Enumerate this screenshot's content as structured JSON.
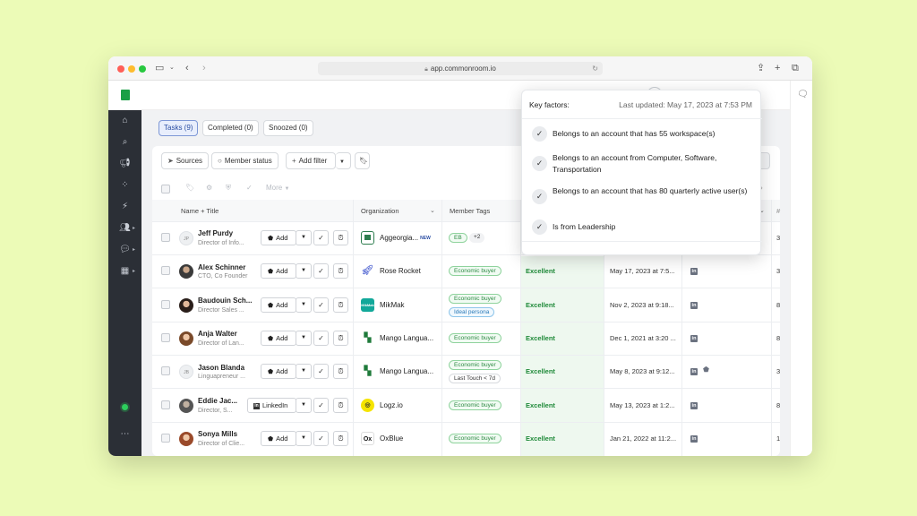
{
  "browser": {
    "url": "app.commonroom.io"
  },
  "tabs": [
    {
      "label": "Tasks (9)",
      "active": true
    },
    {
      "label": "Completed (0)",
      "active": false
    },
    {
      "label": "Snoozed (0)",
      "active": false
    }
  ],
  "filters": {
    "sources": "Sources",
    "member_status": "Member status",
    "add_filter": "Add filter"
  },
  "toolbar": {
    "more": "More"
  },
  "columns": {
    "name_title": "Name + Title",
    "organization": "Organization",
    "member_tags": "Member Tags"
  },
  "rows": [
    {
      "avatar": "JP",
      "name": "Jeff Purdy",
      "title": "Director of Info...",
      "action": "Add",
      "org": "Aggeorgia...",
      "org_new": "NEW",
      "tags": [
        "EB",
        "+2"
      ],
      "score": "",
      "date": ""
    },
    {
      "avatar": "",
      "name": "Alex Schinner",
      "title": "CTO, Co Founder",
      "action": "Add",
      "org": "Rose Rocket",
      "tags": [
        "Economic buyer"
      ],
      "score": "Excellent",
      "date": "May 17, 2023 at 7:5..."
    },
    {
      "avatar": "",
      "name": "Baudouin Sch...",
      "title": "Director Sales ...",
      "action": "Add",
      "org": "MikMak",
      "tags": [
        "Economic buyer",
        "Ideal persona"
      ],
      "score": "Excellent",
      "date": "Nov 2, 2023 at 9:18..."
    },
    {
      "avatar": "",
      "name": "Anja Walter",
      "title": "Director of Lan...",
      "action": "Add",
      "org": "Mango Langua...",
      "tags": [
        "Economic buyer"
      ],
      "score": "Excellent",
      "date": "Dec 1, 2021 at 3:20 ..."
    },
    {
      "avatar": "JB",
      "name": "Jason Blanda",
      "title": "Linguapreneur ...",
      "action": "Add",
      "org": "Mango Langua...",
      "tags": [
        "Economic buyer",
        "Last Touch < 7d"
      ],
      "score": "Excellent",
      "date": "May 8, 2023 at 9:12..."
    },
    {
      "avatar": "",
      "name": "Eddie Jac...",
      "title": "Director, S...",
      "action": "LinkedIn",
      "org": "Logz.io",
      "tags": [
        "Economic buyer"
      ],
      "score": "Excellent",
      "date": "May 13, 2023 at 1:2..."
    },
    {
      "avatar": "",
      "name": "Sonya Mills",
      "title": "Director of Clie...",
      "action": "Add",
      "org": "OxBlue",
      "tags": [
        "Economic buyer"
      ],
      "score": "Excellent",
      "date": "Jan 21, 2022 at 11:2..."
    }
  ],
  "last_col": [
    "3",
    "3",
    "8",
    "8",
    "3",
    "8",
    "1"
  ],
  "partial": {
    "hash": "#",
    "ns": "ns"
  },
  "org_logos": {
    "mikmak": "MikMak",
    "oxblue": "Ox"
  },
  "popup": {
    "title": "Key factors:",
    "updated": "Last updated: May 17, 2023 at 7:53 PM",
    "factors": [
      "Belongs to an account that has 55 workspace(s)",
      "Belongs to an account from Computer, Software, Transportation",
      "Belongs to an account that has 80 quarterly active user(s)",
      "Is from Leadership"
    ]
  },
  "colors": {
    "background": "#ecfbb7",
    "sidebar": "#2b2f36",
    "accent_green": "#1f8a39",
    "active_tab": "#2c4fa4"
  }
}
